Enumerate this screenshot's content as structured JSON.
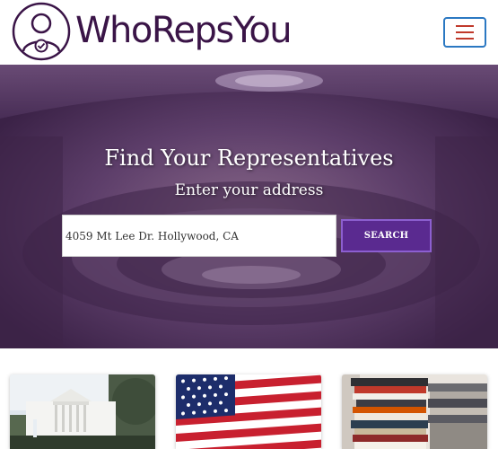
{
  "header": {
    "logo_text": "WhoRepsYou",
    "logo_icon": "person-check-icon",
    "menu_icon": "hamburger-menu-icon"
  },
  "hero": {
    "title": "Find Your Representatives",
    "subtitle": "Enter your address",
    "address_value": "4059 Mt Lee Dr. Hollywood, CA",
    "search_label": "SEARCH"
  },
  "cards": [
    {
      "image": "white-house-image"
    },
    {
      "image": "american-flag-image"
    },
    {
      "image": "stack-of-books-image"
    }
  ],
  "colors": {
    "brand": "#3a1447",
    "hero_overlay": "#4c2f58",
    "search_button": "#5a2a90",
    "menu_border": "#2b78c2",
    "menu_bars": "#c0392b"
  }
}
